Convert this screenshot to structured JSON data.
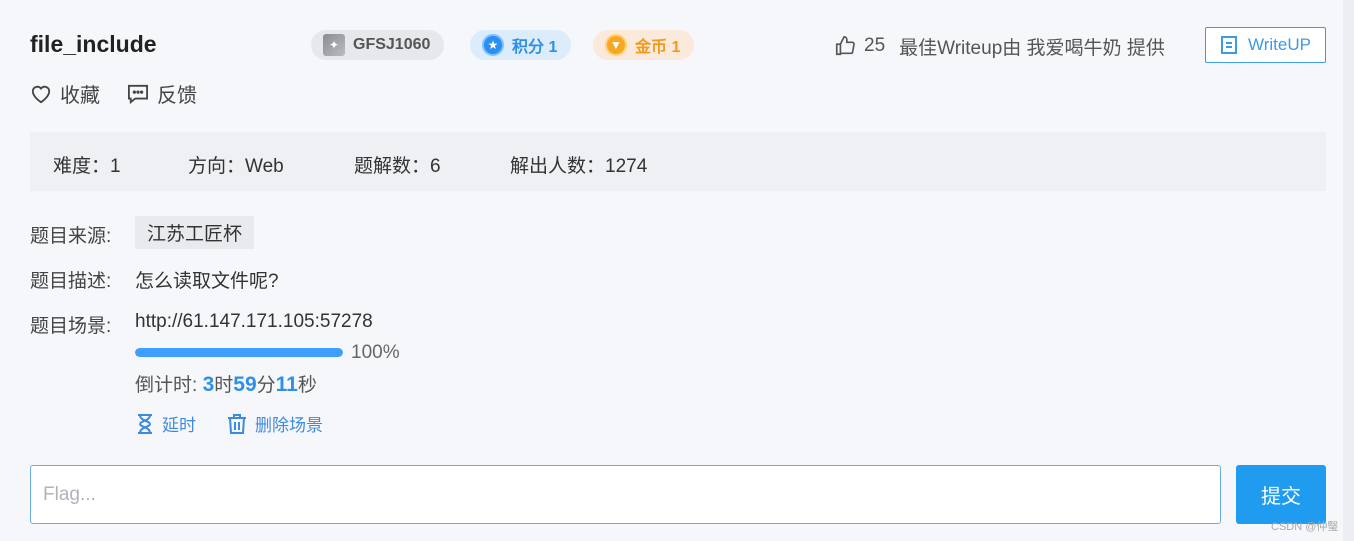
{
  "header": {
    "title": "file_include",
    "badges": {
      "id": "GFSJ1060",
      "score": "积分 1",
      "coin": "金币 1"
    },
    "likes_count": "25",
    "best_writeup_text": "最佳Writeup由 我爱喝牛奶 提供",
    "writeup_button": "WriteUP"
  },
  "actions": {
    "favorite": "收藏",
    "feedback": "反馈"
  },
  "info": {
    "difficulty": "难度：1",
    "direction": "方向：Web",
    "solutions": "题解数：6",
    "solvers": "解出人数：1274"
  },
  "details": {
    "source_label": "题目来源:",
    "source_value": "江苏工匠杯",
    "desc_label": "题目描述:",
    "desc_value": "怎么读取文件呢?",
    "scene_label": "题目场景:",
    "scene_url": "http://61.147.171.105:57278",
    "progress": 100,
    "progress_text": "100%",
    "countdown_prefix": "倒计时: ",
    "hours": "3",
    "hours_unit": "时",
    "minutes": "59",
    "minutes_unit": "分",
    "seconds": "11",
    "seconds_unit": "秒",
    "delay_label": "延时",
    "delete_label": "删除场景"
  },
  "flag": {
    "placeholder": "Flag...",
    "submit_label": "提交"
  },
  "watermark": "CSDN @仲瑿",
  "colors": {
    "accent": "#409eff",
    "link": "#3d8be0",
    "submit": "#1f9bf0"
  }
}
